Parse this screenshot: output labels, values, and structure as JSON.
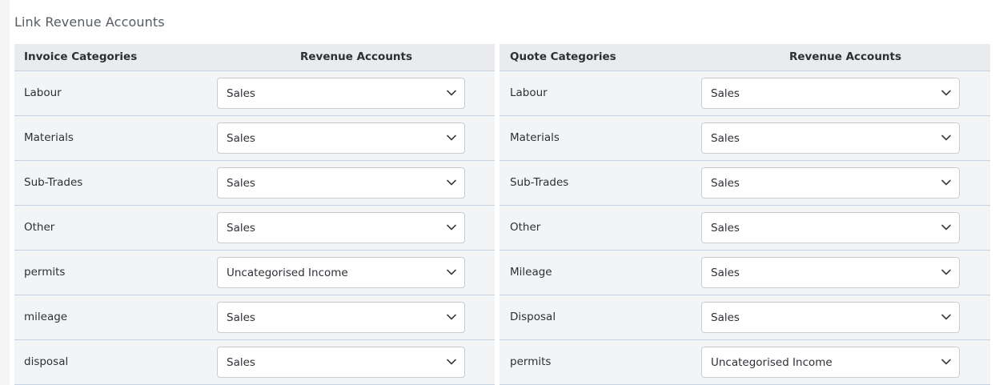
{
  "page": {
    "title": "Link Revenue Accounts"
  },
  "invoice": {
    "header_category": "Invoice Categories",
    "header_account": "Revenue Accounts",
    "rows": [
      {
        "category": "Labour",
        "account": "Sales"
      },
      {
        "category": "Materials",
        "account": "Sales"
      },
      {
        "category": "Sub-Trades",
        "account": "Sales"
      },
      {
        "category": "Other",
        "account": "Sales"
      },
      {
        "category": "permits",
        "account": "Uncategorised Income"
      },
      {
        "category": "mileage",
        "account": "Sales"
      },
      {
        "category": "disposal",
        "account": "Sales"
      }
    ]
  },
  "quote": {
    "header_category": "Quote Categories",
    "header_account": "Revenue Accounts",
    "rows": [
      {
        "category": "Labour",
        "account": "Sales"
      },
      {
        "category": "Materials",
        "account": "Sales"
      },
      {
        "category": "Sub-Trades",
        "account": "Sales"
      },
      {
        "category": "Other",
        "account": "Sales"
      },
      {
        "category": "Mileage",
        "account": "Sales"
      },
      {
        "category": "Disposal",
        "account": "Sales"
      },
      {
        "category": "permits",
        "account": "Uncategorised Income"
      }
    ]
  },
  "icons": {
    "dropdown": "chevron-down-icon"
  },
  "colors": {
    "header_bg": "#e9ebee",
    "row_bg": "#f3f4f6",
    "row_border": "#c7d3e0",
    "text": "#2c3035"
  }
}
